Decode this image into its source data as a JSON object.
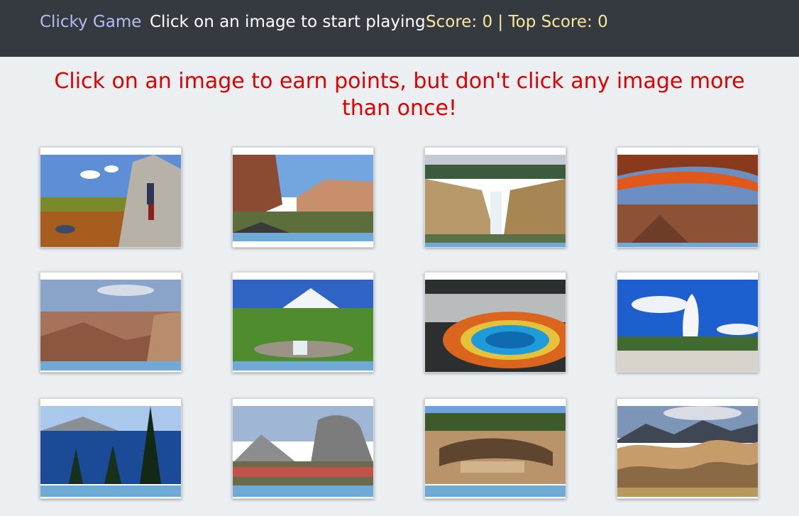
{
  "navbar": {
    "brand": "Clicky Game",
    "message": "Click on an image to start playing",
    "score": "Score: 0 | Top Score: 0"
  },
  "instructions": "Click on an image to earn points, but don't click any image more than once!",
  "images": [
    {
      "name": "hiker-autumn"
    },
    {
      "name": "canyon-road"
    },
    {
      "name": "waterfall-canyon"
    },
    {
      "name": "mesa-arch"
    },
    {
      "name": "grand-canyon"
    },
    {
      "name": "mountain-stream"
    },
    {
      "name": "prismatic-spring"
    },
    {
      "name": "geyser"
    },
    {
      "name": "crater-lake"
    },
    {
      "name": "half-dome"
    },
    {
      "name": "cliff-dwelling"
    },
    {
      "name": "sand-dunes"
    }
  ]
}
